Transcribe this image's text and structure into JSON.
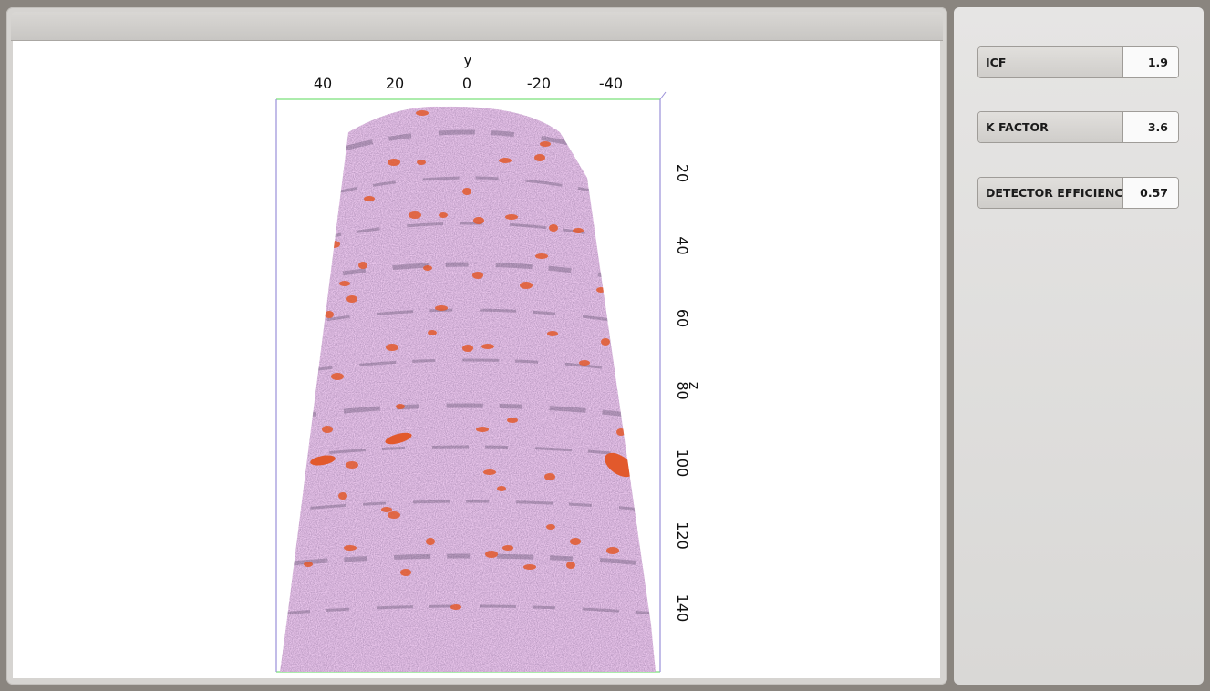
{
  "viewer": {
    "axes": {
      "y_axis_label": "y",
      "z_axis_label": "z",
      "y_ticks": [
        "40",
        "20",
        "0",
        "-20",
        "-40"
      ],
      "z_ticks": [
        "20",
        "40",
        "60",
        "80",
        "100",
        "120",
        "140"
      ]
    },
    "colors": {
      "point_cloud": "#e3b6e6",
      "dense_points": "#5a4a66",
      "clusters": "#e2592c",
      "box_top": "#7be07b",
      "box_side": "#9a8fd8"
    }
  },
  "parameters": [
    {
      "label": "ICF",
      "value": "1.9"
    },
    {
      "label": "K FACTOR",
      "value": "3.6"
    },
    {
      "label": "DETECTOR EFFICIENCY",
      "value": "0.57"
    }
  ]
}
